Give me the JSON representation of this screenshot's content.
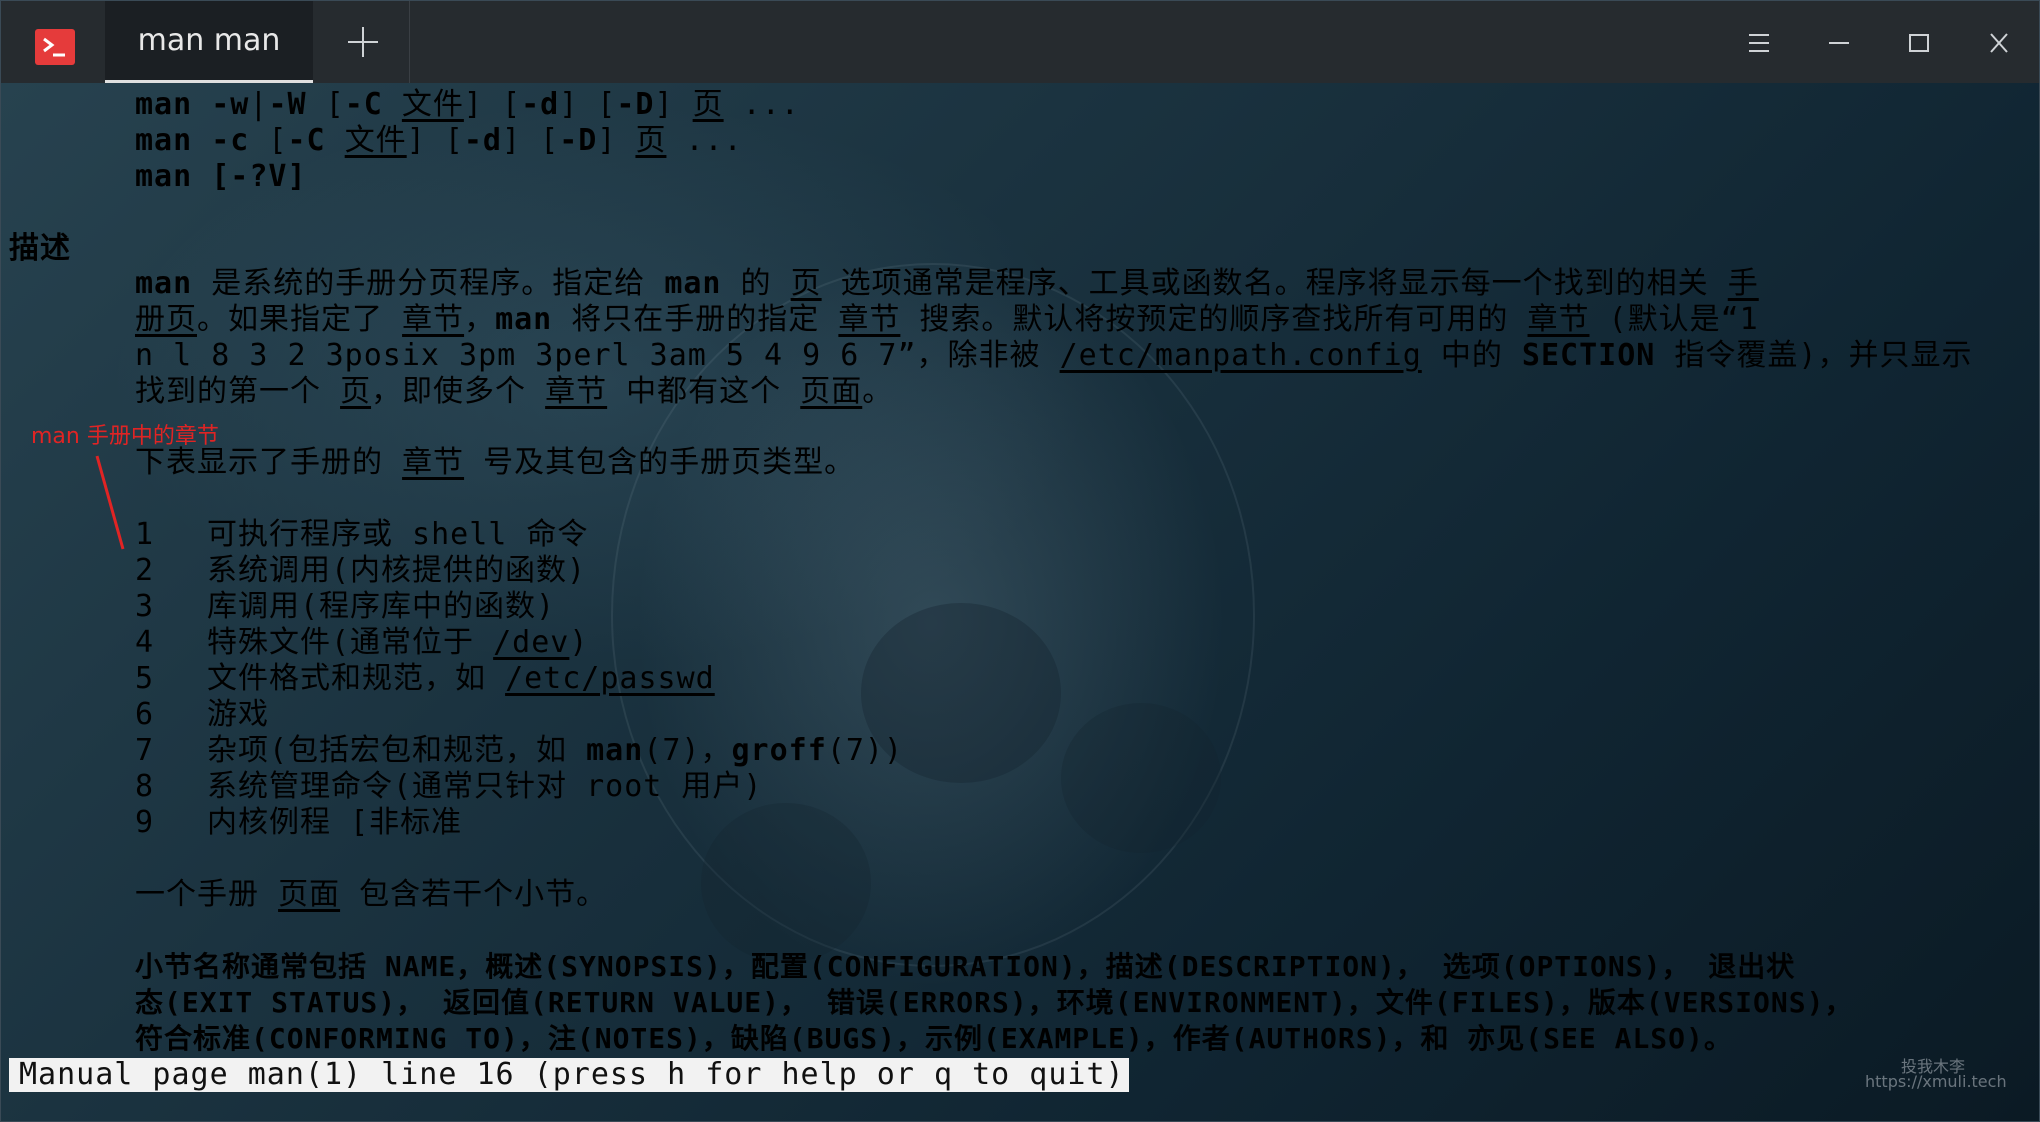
{
  "titlebar": {
    "tab_title": "man man",
    "icons": [
      "terminal-icon",
      "plus-icon",
      "menu-icon",
      "minimize-icon",
      "maximize-icon",
      "close-icon"
    ]
  },
  "terminal": {
    "synopsis": {
      "l1": [
        "man",
        " -w",
        "|",
        "-W",
        " [",
        "-C",
        " ",
        "文件",
        "] [",
        "-d",
        "] [",
        "-D",
        "] ",
        "页",
        " ..."
      ],
      "l2": [
        "man",
        " -c",
        " [",
        "-C",
        " ",
        "文件",
        "] [",
        "-d",
        "] [",
        "-D",
        "] ",
        "页",
        " ..."
      ],
      "l3": [
        "man",
        " [-?V]"
      ]
    },
    "section_heading": "描述",
    "description": {
      "l1": [
        "man",
        " 是系统的手册分页程序。指定给 ",
        "man",
        " 的 ",
        "页",
        " 选项通常是程序、工具或函数名。程序将显示每一个找到的相关 ",
        "手"
      ],
      "l2": [
        "册页",
        "。如果指定了 ",
        "章节",
        "，",
        "man",
        " 将只在手册的指定 ",
        "章节",
        " 搜索。默认将按预定的顺序查找所有可用的 ",
        "章节",
        " (默认是“1"
      ],
      "l3": [
        "n l 8 3 2 3posix 3pm 3perl 3am 5 4 9 6 7”，除非被 ",
        "/etc/manpath.config",
        " 中的 ",
        "SECTION",
        " 指令覆盖)，并只显示"
      ],
      "l4": [
        "找到的第一个 ",
        "页",
        "，即使多个 ",
        "章节",
        " 中都有这个 ",
        "页面",
        "。"
      ]
    },
    "table_intro": [
      "下表显示了手册的 ",
      "章节",
      " 号及其包含的手册页类型。"
    ],
    "sections": [
      {
        "num": "1",
        "desc": [
          "可执行程序或 shell 命令"
        ]
      },
      {
        "num": "2",
        "desc": [
          "系统调用(内核提供的函数)"
        ]
      },
      {
        "num": "3",
        "desc": [
          "库调用(程序库中的函数)"
        ]
      },
      {
        "num": "4",
        "desc": [
          "特殊文件(通常位于 ",
          "/dev",
          ")"
        ]
      },
      {
        "num": "5",
        "desc": [
          "文件格式和规范，如 ",
          "/etc/passwd"
        ]
      },
      {
        "num": "6",
        "desc": [
          "游戏"
        ]
      },
      {
        "num": "7",
        "desc": [
          "杂项(包括宏包和规范，如 ",
          "man",
          "(7)，",
          "groff",
          "(7))"
        ]
      },
      {
        "num": "8",
        "desc": [
          "系统管理命令(通常只针对 root 用户)"
        ]
      },
      {
        "num": "9",
        "desc": [
          "内核例程 [非标准"
        ]
      }
    ],
    "page_sentence": [
      "一个手册 ",
      "页面",
      " 包含若干个小节。"
    ],
    "names": {
      "l1": "小节名称通常包括 NAME，概述(SYNOPSIS)，配置(CONFIGURATION)，描述(DESCRIPTION)， 选项(OPTIONS)， 退出状",
      "l2": "态(EXIT STATUS)， 返回值(RETURN VALUE)， 错误(ERRORS)，环境(ENVIRONMENT)，文件(FILES)，版本(VERSIONS)，",
      "l3": "符合标准(CONFORMING TO)，注(NOTES)，缺陷(BUGS)，示例(EXAMPLE)，作者(AUTHORS)，和 亦见(SEE ALSO)。"
    },
    "status_line": "Manual page man(1) line 16 (press h for help or q to quit)"
  },
  "annotation": {
    "label": "man 手册中的章节",
    "color": "#e02424"
  },
  "watermark": {
    "l1": "投我木李",
    "l2": "https://xmuli.tech"
  }
}
